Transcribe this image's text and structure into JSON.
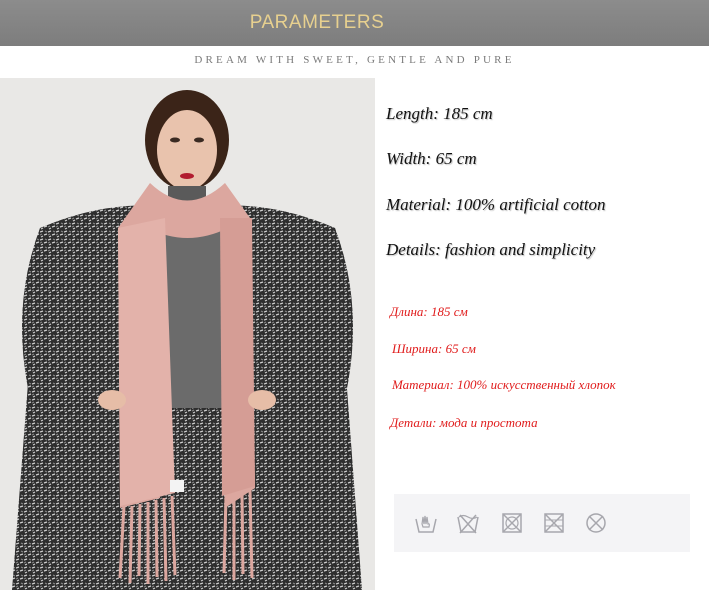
{
  "banner": {
    "title": "PARAMETERS"
  },
  "tagline": "DREAM WITH SWEET, GENTLE AND PURE",
  "specs_en": [
    "Length: 185 cm",
    "Width: 65 cm",
    "Material: 100% artificial cotton",
    "Details: fashion and simplicity"
  ],
  "specs_ru": [
    "Длина: 185 см",
    "Ширина: 65 см",
    "Материал: 100% искусственный хлопок",
    "Детали: мода и простота"
  ],
  "care_icons": [
    "hand-wash-30-icon",
    "no-wash-icon",
    "no-tumble-dry-icon",
    "no-bleach-icon",
    "no-dry-clean-icon"
  ],
  "colors": {
    "banner_bg": "#858585",
    "banner_text": "#e7d08f",
    "russian_text": "#e01b1b",
    "scarf": "#dca79f",
    "coat": "#3a3a3a"
  }
}
